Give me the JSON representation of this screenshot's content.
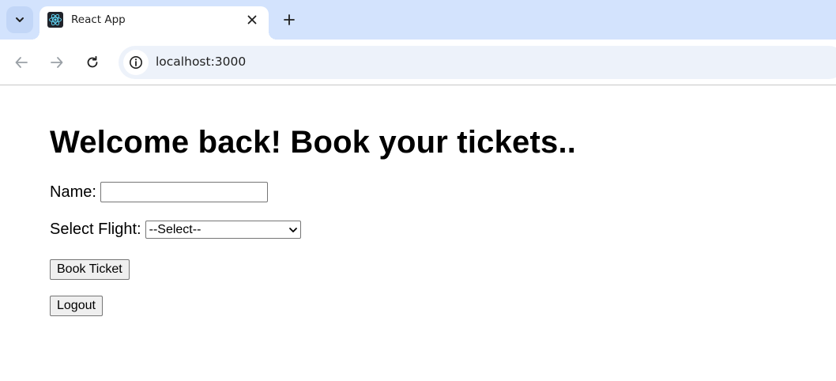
{
  "browser": {
    "tab_title": "React App",
    "url": "localhost:3000"
  },
  "page": {
    "heading": "Welcome back! Book your tickets..",
    "name_label": "Name:",
    "name_value": "",
    "flight_label": "Select Flight:",
    "flight_selected": "--Select--",
    "book_button": "Book Ticket",
    "logout_button": "Logout"
  },
  "icons": {
    "tab_search": "chevron-down-icon",
    "favicon": "react-logo-icon",
    "tab_close": "close-icon",
    "new_tab": "plus-icon",
    "back": "arrow-left-icon",
    "forward": "arrow-right-icon",
    "reload": "reload-icon",
    "site_info": "info-icon"
  },
  "colors": {
    "tabstrip": "#d3e3fd",
    "omnibox": "#edf2fa",
    "react_blue": "#61dafb"
  }
}
